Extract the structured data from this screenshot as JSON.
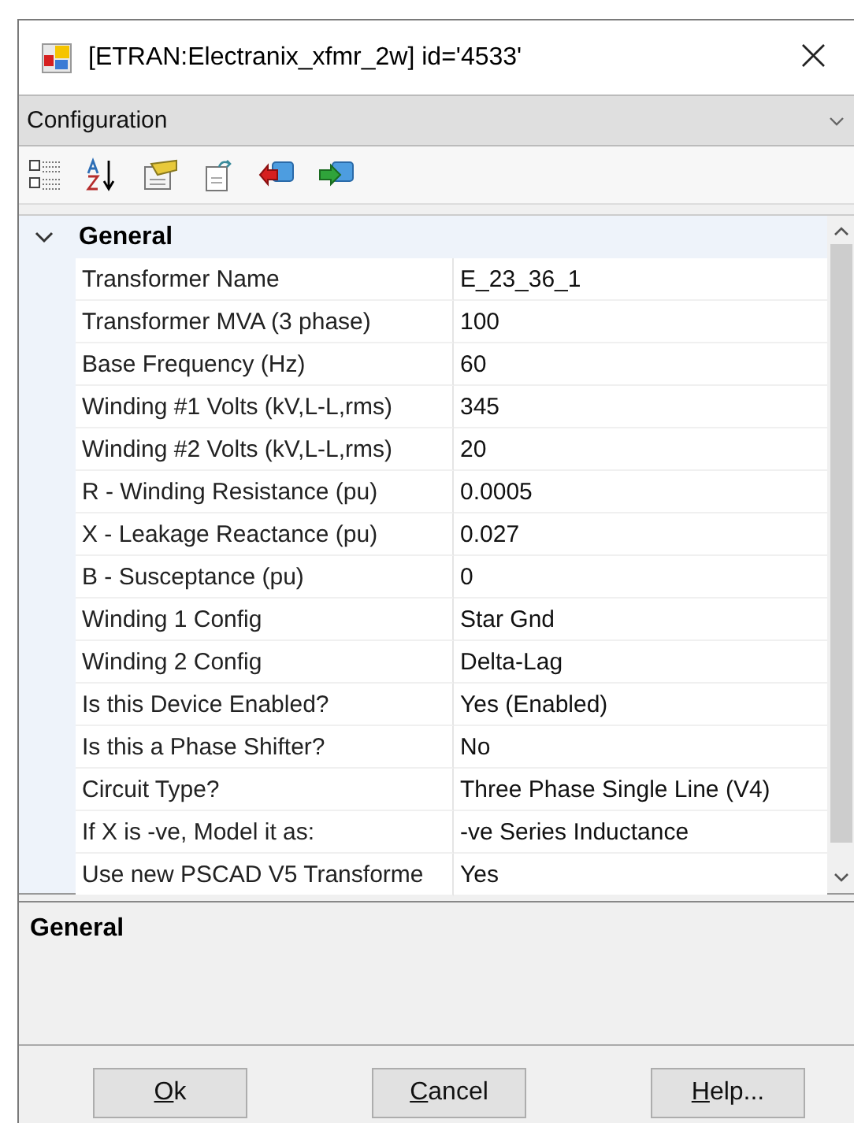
{
  "window": {
    "title": "[ETRAN:Electranix_xfmr_2w] id='4533'",
    "close": "×"
  },
  "panel": {
    "title": "Configuration"
  },
  "grid": {
    "categories": [
      {
        "name": "General",
        "expanded": true,
        "rows": [
          {
            "label": "Transformer Name",
            "value": "E_23_36_1"
          },
          {
            "label": "Transformer MVA (3 phase)",
            "value": "100"
          },
          {
            "label": "Base Frequency (Hz)",
            "value": "60"
          },
          {
            "label": "Winding #1 Volts (kV,L-L,rms)",
            "value": "345"
          },
          {
            "label": "Winding #2 Volts (kV,L-L,rms)",
            "value": "20"
          },
          {
            "label": "R - Winding Resistance (pu)",
            "value": "0.0005"
          },
          {
            "label": "X - Leakage Reactance (pu)",
            "value": "0.027"
          },
          {
            "label": "B - Susceptance (pu)",
            "value": "0"
          },
          {
            "label": "Winding 1 Config",
            "value": "Star Gnd"
          },
          {
            "label": "Winding 2 Config",
            "value": "Delta-Lag"
          },
          {
            "label": "Is this Device Enabled?",
            "value": "Yes (Enabled)"
          },
          {
            "label": "Is this a Phase Shifter?",
            "value": "No"
          },
          {
            "label": "Circuit Type?",
            "value": "Three Phase Single Line (V4)"
          },
          {
            "label": "If X is -ve, Model it as:",
            "value": "-ve Series Inductance"
          },
          {
            "label": "Use new PSCAD V5 Transforme",
            "value": "Yes"
          }
        ]
      }
    ]
  },
  "description": {
    "title": "General"
  },
  "buttons": [
    {
      "label": "Ok"
    },
    {
      "label": "Cancel"
    },
    {
      "label": "Help..."
    }
  ]
}
